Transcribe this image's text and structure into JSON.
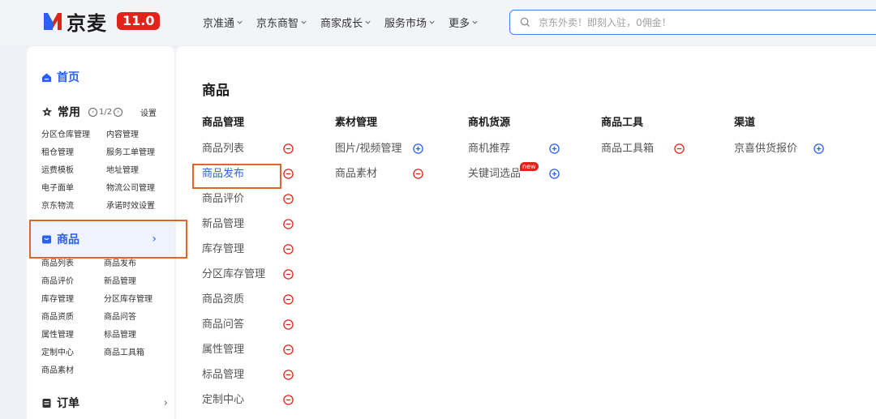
{
  "header": {
    "brand": "京麦",
    "version": "11.0",
    "nav": [
      "京准通",
      "京东商智",
      "商家成长",
      "服务市场",
      "更多"
    ],
    "search_placeholder": "京东外卖！即刻入驻，0佣金！"
  },
  "sidebar": {
    "home": "首页",
    "common": {
      "label": "常用",
      "pager": "1/2",
      "settings": "设置",
      "items": [
        "分区仓库管理",
        "内容管理",
        "租仓管理",
        "服务工单管理",
        "运费模板",
        "地址管理",
        "电子面单",
        "物流公司管理",
        "京东物流",
        "承诺时效设置"
      ]
    },
    "product": {
      "label": "商品",
      "items": [
        "商品列表",
        "商品发布",
        "商品评价",
        "新品管理",
        "库存管理",
        "分区库存管理",
        "商品资质",
        "商品问答",
        "属性管理",
        "标品管理",
        "定制中心",
        "商品工具箱",
        "商品素材"
      ]
    },
    "order": "订单"
  },
  "main": {
    "title": "商品",
    "columns": [
      {
        "header": "商品管理",
        "items": [
          {
            "label": "商品列表",
            "action": "remove"
          },
          {
            "label": "商品发布",
            "action": "remove",
            "active": true
          },
          {
            "label": "商品评价",
            "action": "remove"
          },
          {
            "label": "新品管理",
            "action": "remove"
          },
          {
            "label": "库存管理",
            "action": "remove"
          },
          {
            "label": "分区库存管理",
            "action": "remove"
          },
          {
            "label": "商品资质",
            "action": "remove"
          },
          {
            "label": "商品问答",
            "action": "remove"
          },
          {
            "label": "属性管理",
            "action": "remove"
          },
          {
            "label": "标品管理",
            "action": "remove"
          },
          {
            "label": "定制中心",
            "action": "remove"
          }
        ]
      },
      {
        "header": "素材管理",
        "items": [
          {
            "label": "图片/视频管理",
            "action": "add"
          },
          {
            "label": "商品素材",
            "action": "remove"
          }
        ]
      },
      {
        "header": "商机货源",
        "items": [
          {
            "label": "商机推荐",
            "action": "add"
          },
          {
            "label": "关键词选品",
            "action": "add",
            "badge": "new"
          }
        ]
      },
      {
        "header": "商品工具",
        "items": [
          {
            "label": "商品工具箱",
            "action": "remove"
          }
        ]
      },
      {
        "header": "渠道",
        "items": [
          {
            "label": "京喜供货报价",
            "action": "add"
          }
        ]
      }
    ]
  },
  "colors": {
    "accent": "#2b61f0",
    "brand_red": "#e2231a",
    "highlight": "#e0662c",
    "remove_icon": "#e2231a",
    "add_icon": "#2b61f0"
  }
}
